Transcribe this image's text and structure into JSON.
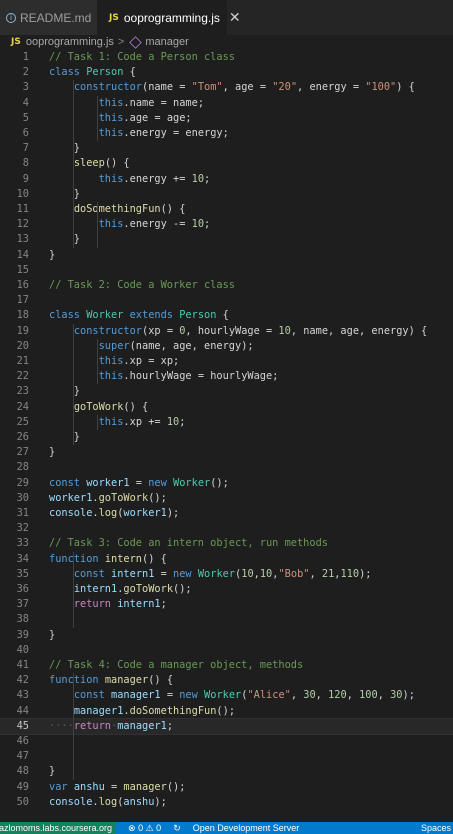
{
  "tabs": [
    {
      "icon": "info-icon",
      "label": "README.md",
      "active": false
    },
    {
      "icon": "js-icon",
      "badge": "JS",
      "label": "ooprogramming.js",
      "active": true
    }
  ],
  "breadcrumb": {
    "file_badge": "JS",
    "file": "ooprogramming.js",
    "separator": ">",
    "symbol": "manager"
  },
  "editor": {
    "active_line": 45,
    "lines": [
      {
        "n": "1",
        "text": "// Task 1: Code a Person class"
      },
      {
        "n": "2",
        "text": "class Person {"
      },
      {
        "n": "3",
        "text": "    constructor(name = \"Tom\", age = \"20\", energy = \"100\") {"
      },
      {
        "n": "4",
        "text": "        this.name = name;"
      },
      {
        "n": "5",
        "text": "        this.age = age;"
      },
      {
        "n": "6",
        "text": "        this.energy = energy;"
      },
      {
        "n": "7",
        "text": "    }"
      },
      {
        "n": "8",
        "text": "    sleep() {"
      },
      {
        "n": "9",
        "text": "        this.energy += 10;"
      },
      {
        "n": "10",
        "text": "    }"
      },
      {
        "n": "11",
        "text": "    doSomethingFun() {"
      },
      {
        "n": "12",
        "text": "        this.energy -= 10;"
      },
      {
        "n": "13",
        "text": "    }"
      },
      {
        "n": "14",
        "text": "}"
      },
      {
        "n": "15",
        "text": ""
      },
      {
        "n": "16",
        "text": "// Task 2: Code a Worker class"
      },
      {
        "n": "17",
        "text": ""
      },
      {
        "n": "18",
        "text": "class Worker extends Person {"
      },
      {
        "n": "19",
        "text": "    constructor(xp = 0, hourlyWage = 10, name, age, energy) {"
      },
      {
        "n": "20",
        "text": "        super(name, age, energy);"
      },
      {
        "n": "21",
        "text": "        this.xp = xp;"
      },
      {
        "n": "22",
        "text": "        this.hourlyWage = hourlyWage;"
      },
      {
        "n": "23",
        "text": "    }"
      },
      {
        "n": "24",
        "text": "    goToWork() {"
      },
      {
        "n": "25",
        "text": "        this.xp += 10;"
      },
      {
        "n": "26",
        "text": "    }"
      },
      {
        "n": "27",
        "text": "}"
      },
      {
        "n": "28",
        "text": ""
      },
      {
        "n": "29",
        "text": "const worker1 = new Worker();"
      },
      {
        "n": "30",
        "text": "worker1.goToWork();"
      },
      {
        "n": "31",
        "text": "console.log(worker1);"
      },
      {
        "n": "32",
        "text": ""
      },
      {
        "n": "33",
        "text": "// Task 3: Code an intern object, run methods"
      },
      {
        "n": "34",
        "text": "function intern() {"
      },
      {
        "n": "35",
        "text": "    const intern1 = new Worker(10,10,\"Bob\", 21,110);"
      },
      {
        "n": "36",
        "text": "    intern1.goToWork();"
      },
      {
        "n": "37",
        "text": "    return intern1;"
      },
      {
        "n": "38",
        "text": ""
      },
      {
        "n": "39",
        "text": "}"
      },
      {
        "n": "40",
        "text": ""
      },
      {
        "n": "41",
        "text": "// Task 4: Code a manager object, methods"
      },
      {
        "n": "42",
        "text": "function manager() {"
      },
      {
        "n": "43",
        "text": "    const manager1 = new Worker(\"Alice\", 30, 120, 100, 30);"
      },
      {
        "n": "44",
        "text": "    manager1.doSomethingFun();"
      },
      {
        "n": "45",
        "text": "····return·manager1;"
      },
      {
        "n": "46",
        "text": ""
      },
      {
        "n": "47",
        "text": ""
      },
      {
        "n": "48",
        "text": "}"
      },
      {
        "n": "49",
        "text": "var anshu = manager();"
      },
      {
        "n": "50",
        "text": "console.log(anshu);"
      }
    ]
  },
  "statusbar": {
    "remote": "razlomoms.labs.coursera.org",
    "problems": "0 ⚠ 0",
    "sync_icon": "sync-icon",
    "server": "Open Development Server",
    "spaces": "Spaces"
  },
  "colors": {
    "keyword": "#569cd6",
    "comment": "#6a9955",
    "string": "#ce9178",
    "number": "#b5cea8",
    "function": "#dcdcaa",
    "class": "#4ec9b0",
    "variable": "#9cdcfe",
    "control": "#c586c0",
    "statusbar": "#007acc",
    "remote": "#16825d"
  }
}
